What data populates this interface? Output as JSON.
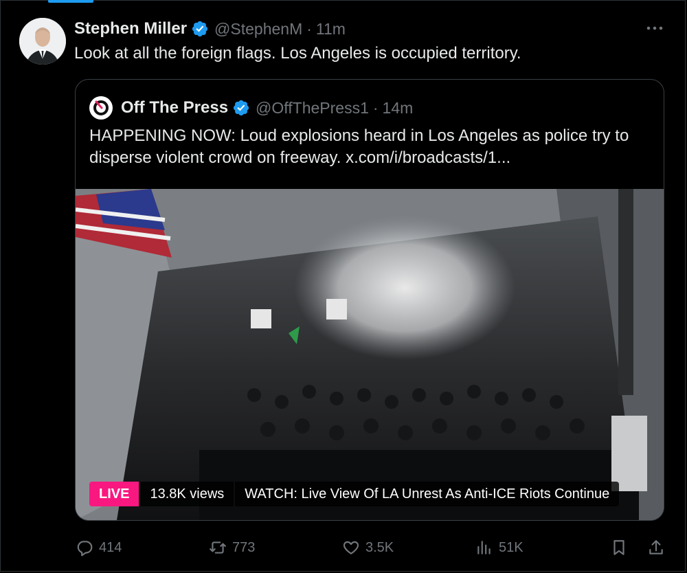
{
  "tweet": {
    "author_name": "Stephen Miller",
    "handle": "@StephenM",
    "separator": "·",
    "time": "11m",
    "text": "Look at all the foreign flags. Los Angeles is occupied territory."
  },
  "quote": {
    "author_name": "Off The Press",
    "handle": "@OffThePress1",
    "separator": "·",
    "time": "14m",
    "text": "HAPPENING NOW: Loud explosions heard in Los Angeles as police try to disperse violent crowd on freeway. x.com/i/broadcasts/1...",
    "broadcast": {
      "live_label": "LIVE",
      "views": "13.8K views",
      "title": "WATCH: Live View Of LA Unrest As Anti-ICE Riots Continue"
    }
  },
  "actions": {
    "replies": "414",
    "reposts": "773",
    "likes": "3.5K",
    "views": "51K"
  },
  "icons": {
    "verified": "verified-badge-icon",
    "more": "more-horizontal-icon",
    "reply": "reply-icon",
    "repost": "repost-icon",
    "like": "heart-icon",
    "views": "analytics-icon",
    "bookmark": "bookmark-icon",
    "share": "share-icon"
  },
  "colors": {
    "background": "#000000",
    "text": "#e7e9ea",
    "secondary": "#71767b",
    "verified": "#1d9bf0",
    "live": "#f91880"
  }
}
